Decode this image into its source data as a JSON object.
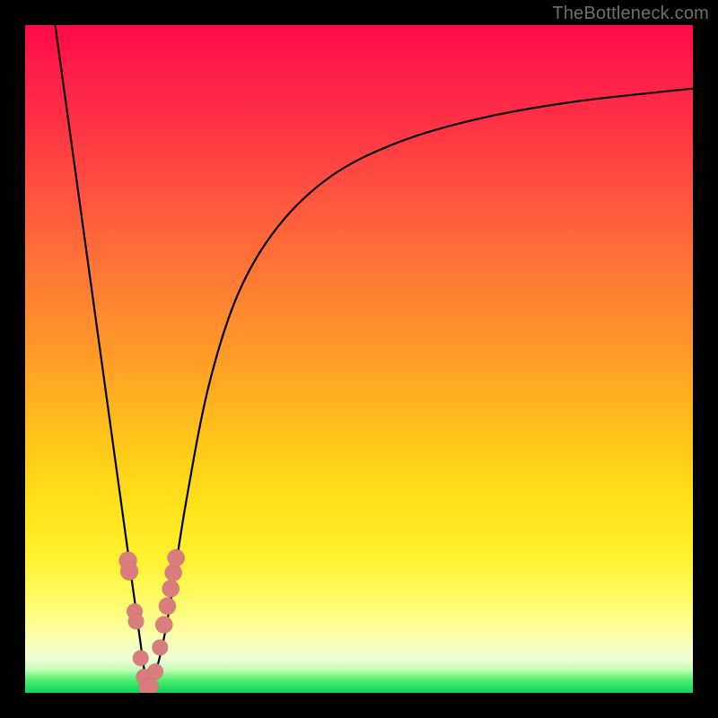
{
  "watermark": {
    "text": "TheBottleneck.com"
  },
  "chart_data": {
    "type": "line",
    "title": "",
    "xlabel": "",
    "ylabel": "",
    "xlim": [
      0,
      100
    ],
    "ylim": [
      0,
      100
    ],
    "background_gradient": {
      "direction": "top-to-bottom",
      "stops": [
        {
          "pos": 0,
          "color": "#ff0a4a"
        },
        {
          "pos": 0.38,
          "color": "#ff7a36"
        },
        {
          "pos": 0.72,
          "color": "#ffe21a"
        },
        {
          "pos": 0.93,
          "color": "#f6ffc2"
        },
        {
          "pos": 1.0,
          "color": "#09d35b"
        }
      ]
    },
    "series": [
      {
        "name": "left-descent",
        "description": "Steep line from near top-left down to the trough",
        "points": [
          {
            "x": 4.5,
            "y": 100
          },
          {
            "x": 18.2,
            "y": 0.8
          }
        ]
      },
      {
        "name": "right-rise",
        "description": "Curve rising from trough, bending right and tapering",
        "points": [
          {
            "x": 18.2,
            "y": 0.8
          },
          {
            "x": 19.8,
            "y": 4
          },
          {
            "x": 21.5,
            "y": 12
          },
          {
            "x": 24.0,
            "y": 28
          },
          {
            "x": 27.5,
            "y": 46
          },
          {
            "x": 32.0,
            "y": 60
          },
          {
            "x": 38.0,
            "y": 70
          },
          {
            "x": 46.0,
            "y": 77.5
          },
          {
            "x": 56.0,
            "y": 82.5
          },
          {
            "x": 68.0,
            "y": 86
          },
          {
            "x": 82.0,
            "y": 88.5
          },
          {
            "x": 100.0,
            "y": 90.5
          }
        ]
      }
    ],
    "markers": [
      {
        "x": 15.4,
        "y": 19.8,
        "r": 1.35
      },
      {
        "x": 15.6,
        "y": 18.2,
        "r": 1.35
      },
      {
        "x": 16.4,
        "y": 12.2,
        "r": 1.2
      },
      {
        "x": 16.6,
        "y": 10.7,
        "r": 1.2
      },
      {
        "x": 17.3,
        "y": 5.2,
        "r": 1.2
      },
      {
        "x": 17.8,
        "y": 2.4,
        "r": 1.2
      },
      {
        "x": 18.2,
        "y": 0.9,
        "r": 1.2
      },
      {
        "x": 18.8,
        "y": 1.0,
        "r": 1.2
      },
      {
        "x": 19.5,
        "y": 3.2,
        "r": 1.2
      },
      {
        "x": 20.2,
        "y": 6.8,
        "r": 1.2
      },
      {
        "x": 20.8,
        "y": 10.2,
        "r": 1.3
      },
      {
        "x": 21.3,
        "y": 13.0,
        "r": 1.3
      },
      {
        "x": 21.8,
        "y": 15.6,
        "r": 1.3
      },
      {
        "x": 22.2,
        "y": 18.0,
        "r": 1.3
      },
      {
        "x": 22.6,
        "y": 20.2,
        "r": 1.3
      }
    ],
    "trough_x": 18.2
  }
}
